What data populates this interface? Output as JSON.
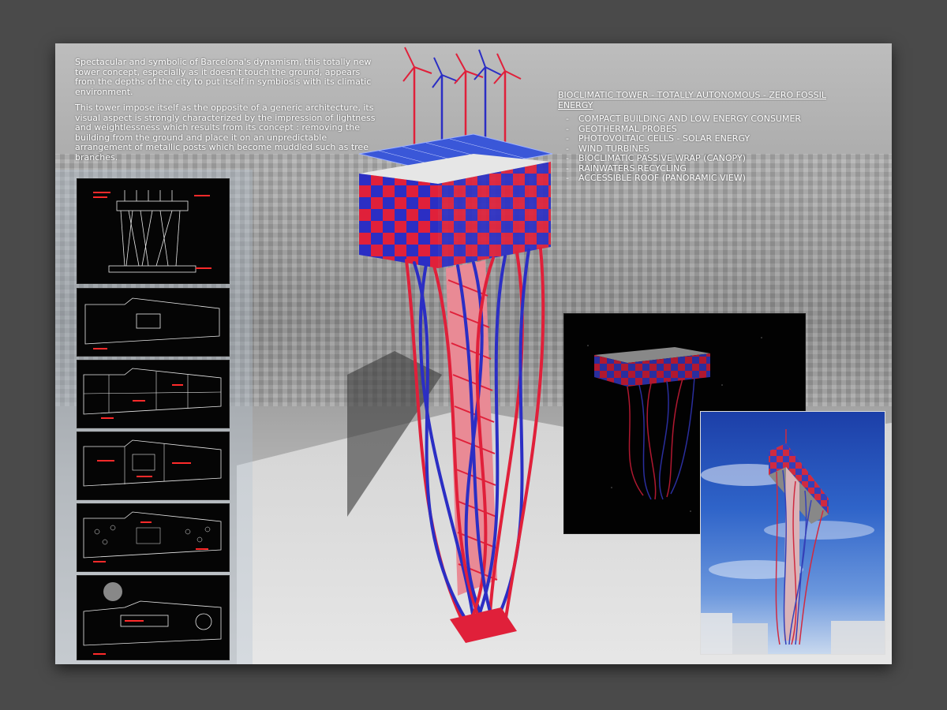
{
  "intro": {
    "paragraph_1": "Spectacular and symbolic of Barcelona's dynamism, this totally new tower concept, especially as it doesn't touch the ground, appears from the depths of the city to put itself in symbiosis with its climatic environment.",
    "paragraph_2": "This tower impose itself as the opposite of a generic architecture, its visual aspect is strongly characterized by the impression of lightness and weightlessness which results from its concept : removing the building from the ground and place it on an unpredictable arrangement of metallic posts which become muddled such as tree branches."
  },
  "features": {
    "title": "BIOCLIMATIC TOWER - TOTALLY AUTONOMOUS - ZERO FOSSIL ENERGY",
    "dash": "-",
    "items": [
      "COMPACT BUILDING AND LOW ENERGY CONSUMER",
      "GEOTHERMAL PROBES",
      "PHOTOVOLTAIC CELLS - SOLAR ENERGY",
      "WIND TURBINES",
      "BIOCLIMATIC PASSIVE WRAP (CANOPY)",
      "RAINWATERS RECYCLING",
      "ACCESSIBLE ROOF (PANORAMIC VIEW)"
    ]
  },
  "colors": {
    "tower_red": "#e0203a",
    "tower_blue": "#2b2ec4",
    "drawing_bg": "#050505",
    "drawing_line": "#e8e8e8",
    "drawing_label": "#ff2a2a"
  }
}
